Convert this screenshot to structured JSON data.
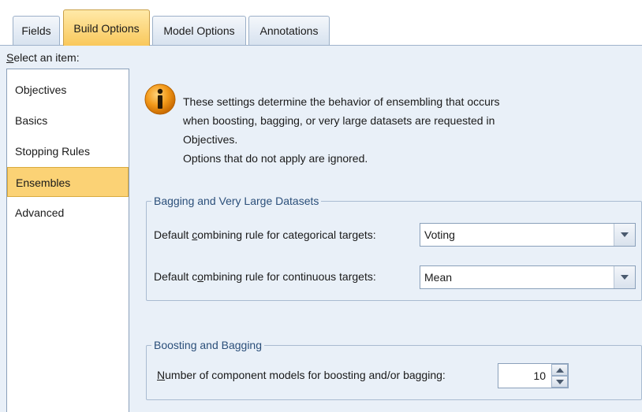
{
  "tabs": [
    {
      "label": "Fields",
      "active": false
    },
    {
      "label": "Build Options",
      "active": true
    },
    {
      "label": "Model Options",
      "active": false
    },
    {
      "label": "Annotations",
      "active": false
    }
  ],
  "sidebar": {
    "label_mnemonic": "S",
    "label_rest": "elect an item:",
    "items": [
      {
        "label": "Objectives",
        "selected": false
      },
      {
        "label": "Basics",
        "selected": false
      },
      {
        "label": "Stopping Rules",
        "selected": false
      },
      {
        "label": "Ensembles",
        "selected": true
      },
      {
        "label": "Advanced",
        "selected": false
      }
    ]
  },
  "info": {
    "icon": "info-icon",
    "lines": [
      "These settings determine the behavior of ensembling that occurs",
      "when boosting, bagging, or very large datasets are requested in",
      "Objectives.",
      "Options that do not apply are ignored."
    ]
  },
  "bagging_group": {
    "title": "Bagging and Very Large Datasets",
    "categorical": {
      "label_pre": "Default ",
      "label_mnemonic": "c",
      "label_post": "ombining rule for categorical targets:",
      "value": "Voting"
    },
    "continuous": {
      "label_pre": "Default c",
      "label_mnemonic": "o",
      "label_post": "mbining rule for continuous targets:",
      "value": "Mean"
    }
  },
  "boosting_group": {
    "title": "Boosting and Bagging",
    "components": {
      "label_mnemonic": "N",
      "label_rest": "umber of component models for boosting and/or bagging:",
      "value": "10"
    }
  },
  "colors": {
    "panel_bg": "#e9f0f8",
    "selected_bg": "#fbd275",
    "group_title": "#2b4f7a",
    "info_icon": "#f08c00"
  }
}
